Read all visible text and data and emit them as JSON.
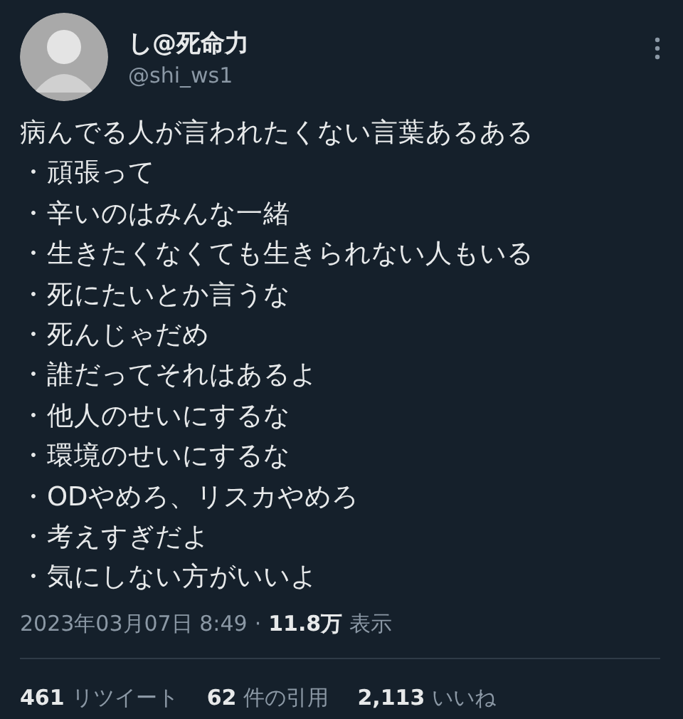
{
  "author": {
    "display_name": "し@死命力",
    "handle": "@shi_ws1"
  },
  "tweet": {
    "lines": [
      "病んでる人が言われたくない言葉あるある",
      "・頑張って",
      "・辛いのはみんな一緒",
      "・生きたくなくても生きられない人もいる",
      "・死にたいとか言うな",
      "・死んじゃだめ",
      "・誰だってそれはあるよ",
      "・他人のせいにするな",
      "・環境のせいにするな",
      "・ODやめろ、リスカやめろ",
      "・考えすぎだよ",
      "・気にしない方がいいよ"
    ]
  },
  "meta": {
    "timestamp": "2023年03月07日 8:49",
    "separator": "·",
    "views_count": "11.8万",
    "views_label": "表示"
  },
  "stats": [
    {
      "count": "461",
      "label": "リツイート"
    },
    {
      "count": "62",
      "label": "件の引用"
    },
    {
      "count": "2,113",
      "label": "いいね"
    }
  ]
}
